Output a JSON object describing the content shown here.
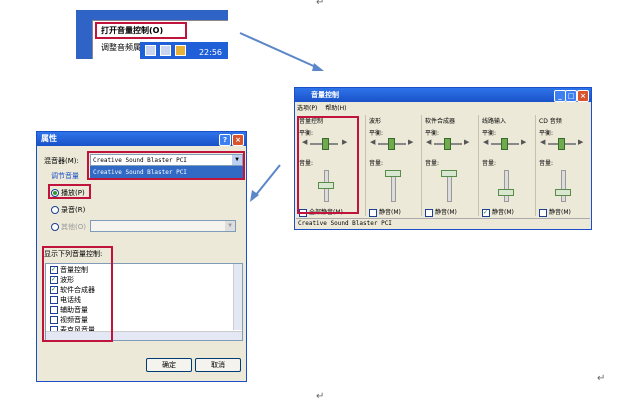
{
  "tray_menu": {
    "item1": "打开音量控制(O)",
    "item2": "调整音频属性(A)",
    "clock": "22:56"
  },
  "mixer": {
    "title": "音量控制",
    "menu": [
      "选项(P)",
      "帮助(H)"
    ],
    "balance_label": "平衡:",
    "volume_label": "音量:",
    "channels": [
      {
        "name": "音量控制",
        "mute": "全部静音(M)",
        "muted": false
      },
      {
        "name": "波形",
        "mute": "静音(M)",
        "muted": false
      },
      {
        "name": "软件合成器",
        "mute": "静音(M)",
        "muted": false
      },
      {
        "name": "线路输入",
        "mute": "静音(M)",
        "muted": true
      },
      {
        "name": "CD 音频",
        "mute": "静音(M)",
        "muted": false
      }
    ],
    "status": "Creative Sound Blaster PCI"
  },
  "props": {
    "title": "属性",
    "mixer_label": "混音器(M):",
    "mixer_value": "Creative Sound Blaster PCI",
    "mixer_option": "Creative Sound Blaster PCI",
    "adjust_label": "调节音量",
    "radio_play": "播放(P)",
    "radio_record": "录音(R)",
    "radio_other": "其他(O)",
    "list_label": "显示下列音量控制:",
    "list_items": [
      {
        "label": "音量控制",
        "checked": true
      },
      {
        "label": "波形",
        "checked": true
      },
      {
        "label": "软件合成器",
        "checked": true
      },
      {
        "label": "电话线",
        "checked": false
      },
      {
        "label": "辅助音量",
        "checked": false
      },
      {
        "label": "视频音量",
        "checked": false
      },
      {
        "label": "麦克风音量",
        "checked": false
      }
    ],
    "ok": "确定",
    "cancel": "取消"
  },
  "colors": {
    "highlight": "#c0143c",
    "titlebar": "#1f5fd8",
    "arrow": "#5b86c8"
  }
}
